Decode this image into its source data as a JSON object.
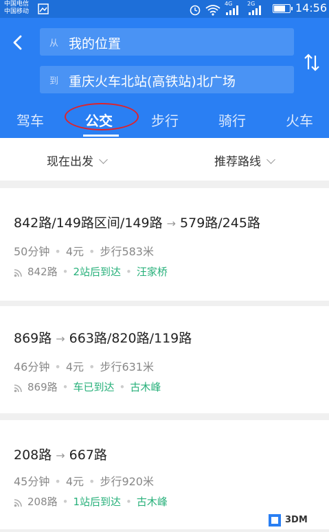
{
  "status_bar": {
    "carrier_line1": "中国电信",
    "carrier_line2": "中国移动",
    "network_1": "4G",
    "network_2": "2G",
    "time": "14:56"
  },
  "search": {
    "from_tag": "从",
    "from_value": "我的位置",
    "to_tag": "到",
    "to_value": "重庆火车北站(高铁站)北广场"
  },
  "tabs": [
    {
      "label": "驾车"
    },
    {
      "label": "公交"
    },
    {
      "label": "步行"
    },
    {
      "label": "骑行"
    },
    {
      "label": "火车"
    }
  ],
  "filters": {
    "departure": "现在出发",
    "sort": "推荐路线"
  },
  "routes": [
    {
      "from_lines": "842路/149路区间/149路",
      "to_lines": "579路/245路",
      "duration": "50分钟",
      "fare": "4元",
      "walk": "步行583米",
      "rt_line": "842路",
      "rt_status": "2站后到达",
      "rt_stop": "汪家桥"
    },
    {
      "from_lines": "869路",
      "to_lines": "663路/820路/119路",
      "duration": "46分钟",
      "fare": "4元",
      "walk": "步行631米",
      "rt_line": "869路",
      "rt_status": "车已到达",
      "rt_stop": "古木峰"
    },
    {
      "from_lines": "208路",
      "to_lines": "667路",
      "duration": "45分钟",
      "fare": "4元",
      "walk": "步行920米",
      "rt_line": "208路",
      "rt_status": "1站后到达",
      "rt_stop": "古木峰"
    }
  ],
  "watermark": {
    "text": "3DM"
  },
  "colors": {
    "header_blue": "#2a7ff3",
    "realtime_green": "#27b07a",
    "highlight_red": "#e0222a"
  }
}
